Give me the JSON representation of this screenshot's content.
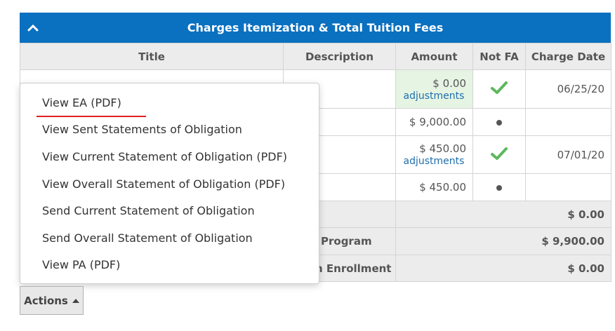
{
  "panel": {
    "title": "Charges Itemization & Total Tuition Fees",
    "header_color": "#0a70c0"
  },
  "table": {
    "columns": [
      "Title",
      "Description",
      "Amount",
      "Not FA",
      "Charge Date"
    ],
    "rows": [
      {
        "amount": "$ 0.00",
        "adjustments": "adjustments",
        "not_fa": "check-icon",
        "date": "06/25/20"
      },
      {
        "amount": "$ 9,000.00",
        "adjustments": "",
        "not_fa": "dot-icon",
        "date": ""
      },
      {
        "amount": "$ 450.00",
        "adjustments": "adjustments",
        "not_fa": "check-icon",
        "date": "07/01/20"
      },
      {
        "amount": "$ 450.00",
        "adjustments": "",
        "not_fa": "dot-icon",
        "date": ""
      }
    ],
    "summary": [
      {
        "label": "",
        "value": "$ 0.00"
      },
      {
        "label": "Program",
        "value": "$ 9,900.00"
      },
      {
        "label": "n Enrollment",
        "value": "$ 0.00"
      }
    ]
  },
  "menu": {
    "items": [
      "View EA (PDF)",
      "View Sent Statements of Obligation",
      "View Current Statement of Obligation (PDF)",
      "View Overall Statement of Obligation (PDF)",
      "Send Current Statement of Obligation",
      "Send Overall Statement of Obligation",
      "View PA (PDF)"
    ]
  },
  "actions": {
    "label": "Actions"
  },
  "colors": {
    "check": "#5cb85c",
    "underline": "#e02020"
  }
}
